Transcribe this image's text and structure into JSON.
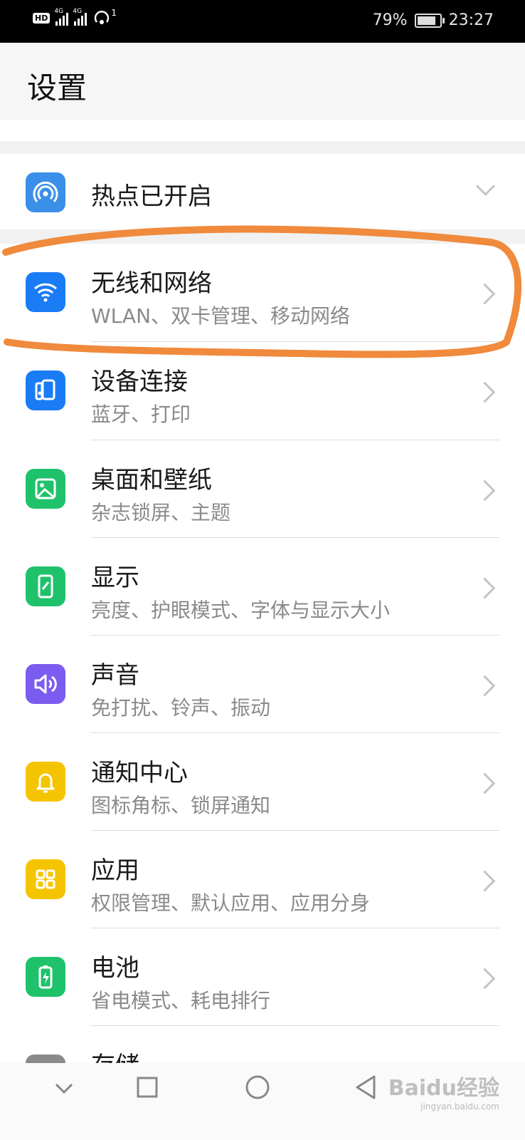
{
  "status": {
    "battery": "79%",
    "time": "23:27",
    "signal1": "4G",
    "signal2": "4G",
    "hd": "HD",
    "hotspot_count": "1"
  },
  "header": {
    "title": "设置"
  },
  "hotspot": {
    "label": "热点已开启"
  },
  "items": [
    {
      "title": "无线和网络",
      "subtitle": "WLAN、双卡管理、移动网络"
    },
    {
      "title": "设备连接",
      "subtitle": "蓝牙、打印"
    },
    {
      "title": "桌面和壁纸",
      "subtitle": "杂志锁屏、主题"
    },
    {
      "title": "显示",
      "subtitle": "亮度、护眼模式、字体与显示大小"
    },
    {
      "title": "声音",
      "subtitle": "免打扰、铃声、振动"
    },
    {
      "title": "通知中心",
      "subtitle": "图标角标、锁屏通知"
    },
    {
      "title": "应用",
      "subtitle": "权限管理、默认应用、应用分身"
    },
    {
      "title": "电池",
      "subtitle": "省电模式、耗电排行"
    },
    {
      "title": "存储",
      "subtitle": ""
    }
  ],
  "colors": {
    "blue": "#1a7cf5",
    "green": "#1fc26b",
    "purple": "#7b5cf0",
    "yellow": "#f5c400",
    "annotation": "#f08a3c"
  },
  "watermark": {
    "brand": "Baidu经验",
    "url": "jingyan.baidu.com"
  }
}
